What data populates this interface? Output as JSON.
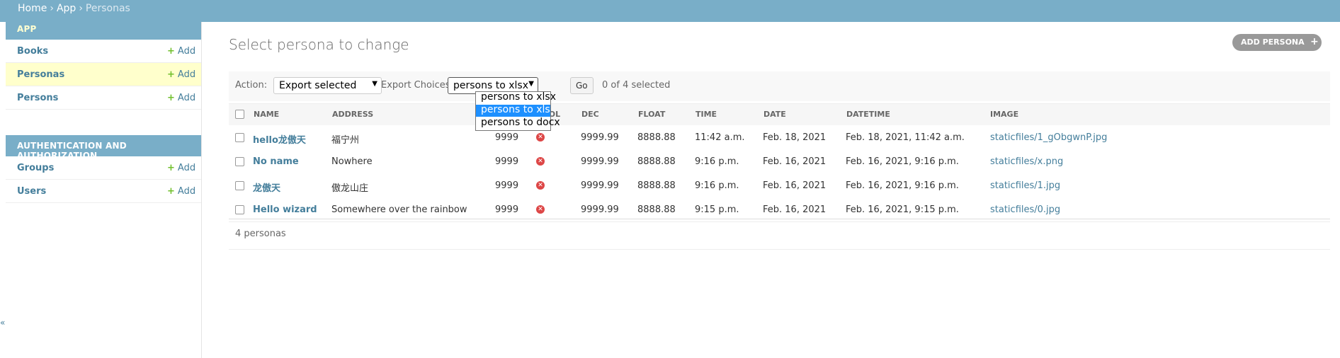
{
  "breadcrumb": {
    "home": "Home",
    "app": "App",
    "current": "Personas",
    "sep": "›"
  },
  "sidebar": {
    "app_module": {
      "title": "APP",
      "items": [
        {
          "label": "Books",
          "add": "Add"
        },
        {
          "label": "Personas",
          "add": "Add"
        },
        {
          "label": "Persons",
          "add": "Add"
        }
      ]
    },
    "auth_module": {
      "title": "AUTHENTICATION AND AUTHORIZATION",
      "items": [
        {
          "label": "Groups",
          "add": "Add"
        },
        {
          "label": "Users",
          "add": "Add"
        }
      ]
    },
    "collapse": "«"
  },
  "main": {
    "title": "Select persona to change",
    "add_button": "ADD PERSONA",
    "add_plus": "+"
  },
  "actions": {
    "action_label": "Action:",
    "action_value": "Export selected",
    "export_label": "Export Choices",
    "export_value": "persons to xlsx",
    "go": "Go",
    "counter": "0 of 4 selected",
    "export_options": [
      "persons to xlsx",
      "persons to xls",
      "persons to docx"
    ],
    "highlighted_option": "persons to xls"
  },
  "table": {
    "columns": [
      "NAME",
      "ADDRESS",
      "BOOL",
      "DEC",
      "FLOAT",
      "TIME",
      "DATE",
      "DATETIME",
      "IMAGE"
    ],
    "rows": [
      {
        "name": "hello龙傲天",
        "address": "福宁州",
        "num": "9999",
        "dec": "9999.99",
        "float": "8888.88",
        "time": "11:42 a.m.",
        "date": "Feb. 18, 2021",
        "datetime": "Feb. 18, 2021, 11:42 a.m.",
        "image": "staticfiles/1_gObgwnP.jpg"
      },
      {
        "name": "No name",
        "address": "Nowhere",
        "num": "9999",
        "dec": "9999.99",
        "float": "8888.88",
        "time": "9:16 p.m.",
        "date": "Feb. 16, 2021",
        "datetime": "Feb. 16, 2021, 9:16 p.m.",
        "image": "staticfiles/x.png"
      },
      {
        "name": "龙傲天",
        "address": "傲龙山庄",
        "num": "9999",
        "dec": "9999.99",
        "float": "8888.88",
        "time": "9:16 p.m.",
        "date": "Feb. 16, 2021",
        "datetime": "Feb. 16, 2021, 9:16 p.m.",
        "image": "staticfiles/1.jpg"
      },
      {
        "name": "Hello wizard",
        "address": "Somewhere over the rainbow",
        "num": "9999",
        "dec": "9999.99",
        "float": "8888.88",
        "time": "9:15 p.m.",
        "date": "Feb. 16, 2021",
        "datetime": "Feb. 16, 2021, 9:15 p.m.",
        "image": "staticfiles/0.jpg"
      }
    ],
    "bool_icon": "✕"
  },
  "footer": {
    "count": "4 personas"
  },
  "colors": {
    "header": "#79aec8",
    "link": "#447e9b",
    "add_green": "#70bf2b",
    "active_row": "#ffffcc",
    "bool_false": "#dd4646"
  }
}
